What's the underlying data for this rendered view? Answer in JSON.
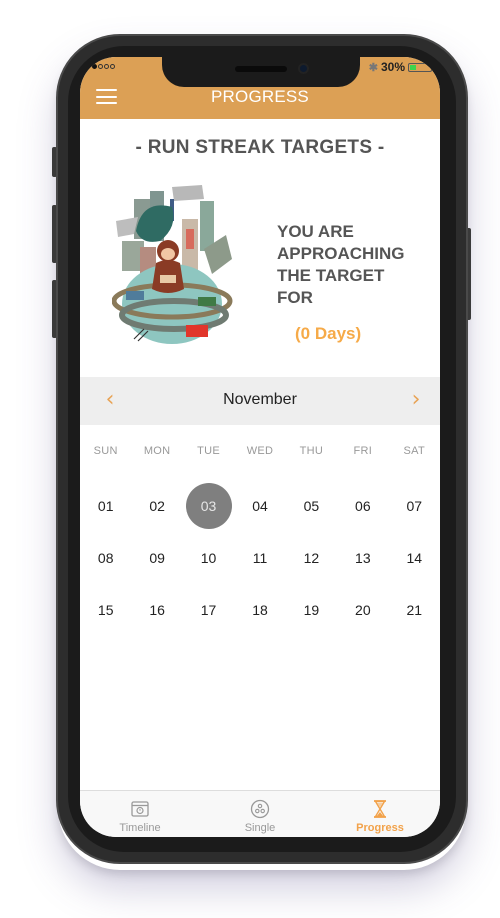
{
  "status_bar": {
    "signal_bars_filled": 1,
    "signal_bars_total": 4,
    "battery_percent_label": "30%",
    "battery_level": 0.3
  },
  "header": {
    "title": "PROGRESS",
    "menu_icon": "hamburger-menu-icon",
    "background_color": "#dca055"
  },
  "section": {
    "title": "- RUN STREAK TARGETS -",
    "illustration": "monkey-meditating-on-globe-city-illustration",
    "message_lines": [
      "YOU ARE",
      "APPROACHING",
      "THE TARGET",
      "FOR"
    ],
    "days_label": "(0 Days)",
    "accent_color": "#f6aa48"
  },
  "calendar": {
    "month": "November",
    "prev_icon": "chevron-left-icon",
    "next_icon": "chevron-right-icon",
    "weekdays": [
      "SUN",
      "MON",
      "TUE",
      "WED",
      "THU",
      "FRI",
      "SAT"
    ],
    "days": [
      "01",
      "02",
      "03",
      "04",
      "05",
      "06",
      "07",
      "08",
      "09",
      "10",
      "11",
      "12",
      "13",
      "14",
      "15",
      "16",
      "17",
      "18",
      "19",
      "20",
      "21"
    ],
    "selected_day": "03"
  },
  "tabbar": {
    "tabs": [
      {
        "label": "Timeline",
        "icon": "calendar-clock-icon",
        "active": false
      },
      {
        "label": "Single",
        "icon": "three-dots-circle-icon",
        "active": false
      },
      {
        "label": "Progress",
        "icon": "hourglass-icon",
        "active": true
      }
    ],
    "active_color": "#f2a24a"
  }
}
